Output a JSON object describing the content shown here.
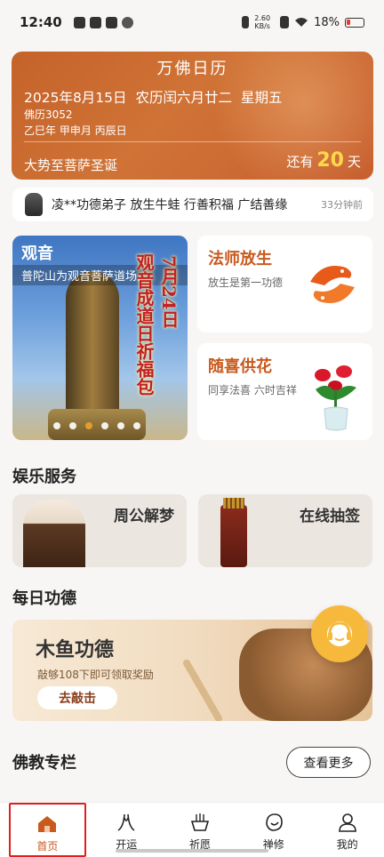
{
  "status_bar": {
    "time": "12:40",
    "net_speed_value": "2.60",
    "net_speed_unit": "KB/s",
    "battery": "18%"
  },
  "calendar": {
    "title": "万佛日历",
    "gregorian": "2025年8月15日",
    "lunar": "农历闰六月廿二",
    "weekday": "星期五",
    "buddhist_year": "佛历3052",
    "ganzhi": "乙巳年 甲申月 丙辰日",
    "event": "大势至菩萨圣诞",
    "countdown_prefix": "还有",
    "countdown_days": "20",
    "countdown_unit": "天"
  },
  "ticker": {
    "text": "凌**功德弟子 放生牛蛙 行善积福 广结善缘",
    "time": "33分钟前"
  },
  "banner": {
    "tag": "观音",
    "subtitle": "普陀山为观音菩萨道场,",
    "vertical_main": "观音成道日祈福包",
    "vertical_date": "7月24日",
    "slide_count": 6,
    "active_slide": 3
  },
  "features": [
    {
      "title": "法师放生",
      "subtitle": "放生是第一功德"
    },
    {
      "title": "随喜供花",
      "subtitle": "同享法喜 六时吉祥"
    }
  ],
  "entertainment": {
    "section_title": "娱乐服务",
    "items": [
      {
        "title": "周公解梦"
      },
      {
        "title": "在线抽签"
      }
    ]
  },
  "daily_merit": {
    "section_title": "每日功德",
    "title": "木鱼功德",
    "subtitle": "敲够108下即可领取奖励",
    "button": "去敲击"
  },
  "column": {
    "section_title": "佛教专栏",
    "more_button": "查看更多"
  },
  "nav": {
    "items": [
      {
        "label": "首页",
        "icon": "home-icon"
      },
      {
        "label": "开运",
        "icon": "fortune-icon"
      },
      {
        "label": "祈愿",
        "icon": "incense-icon"
      },
      {
        "label": "禅修",
        "icon": "meditation-icon"
      },
      {
        "label": "我的",
        "icon": "profile-icon"
      }
    ],
    "active_index": 0
  },
  "colors": {
    "accent": "#c85a1e",
    "calendar_bg": "#c9652e",
    "highlight": "#ffd84a"
  }
}
